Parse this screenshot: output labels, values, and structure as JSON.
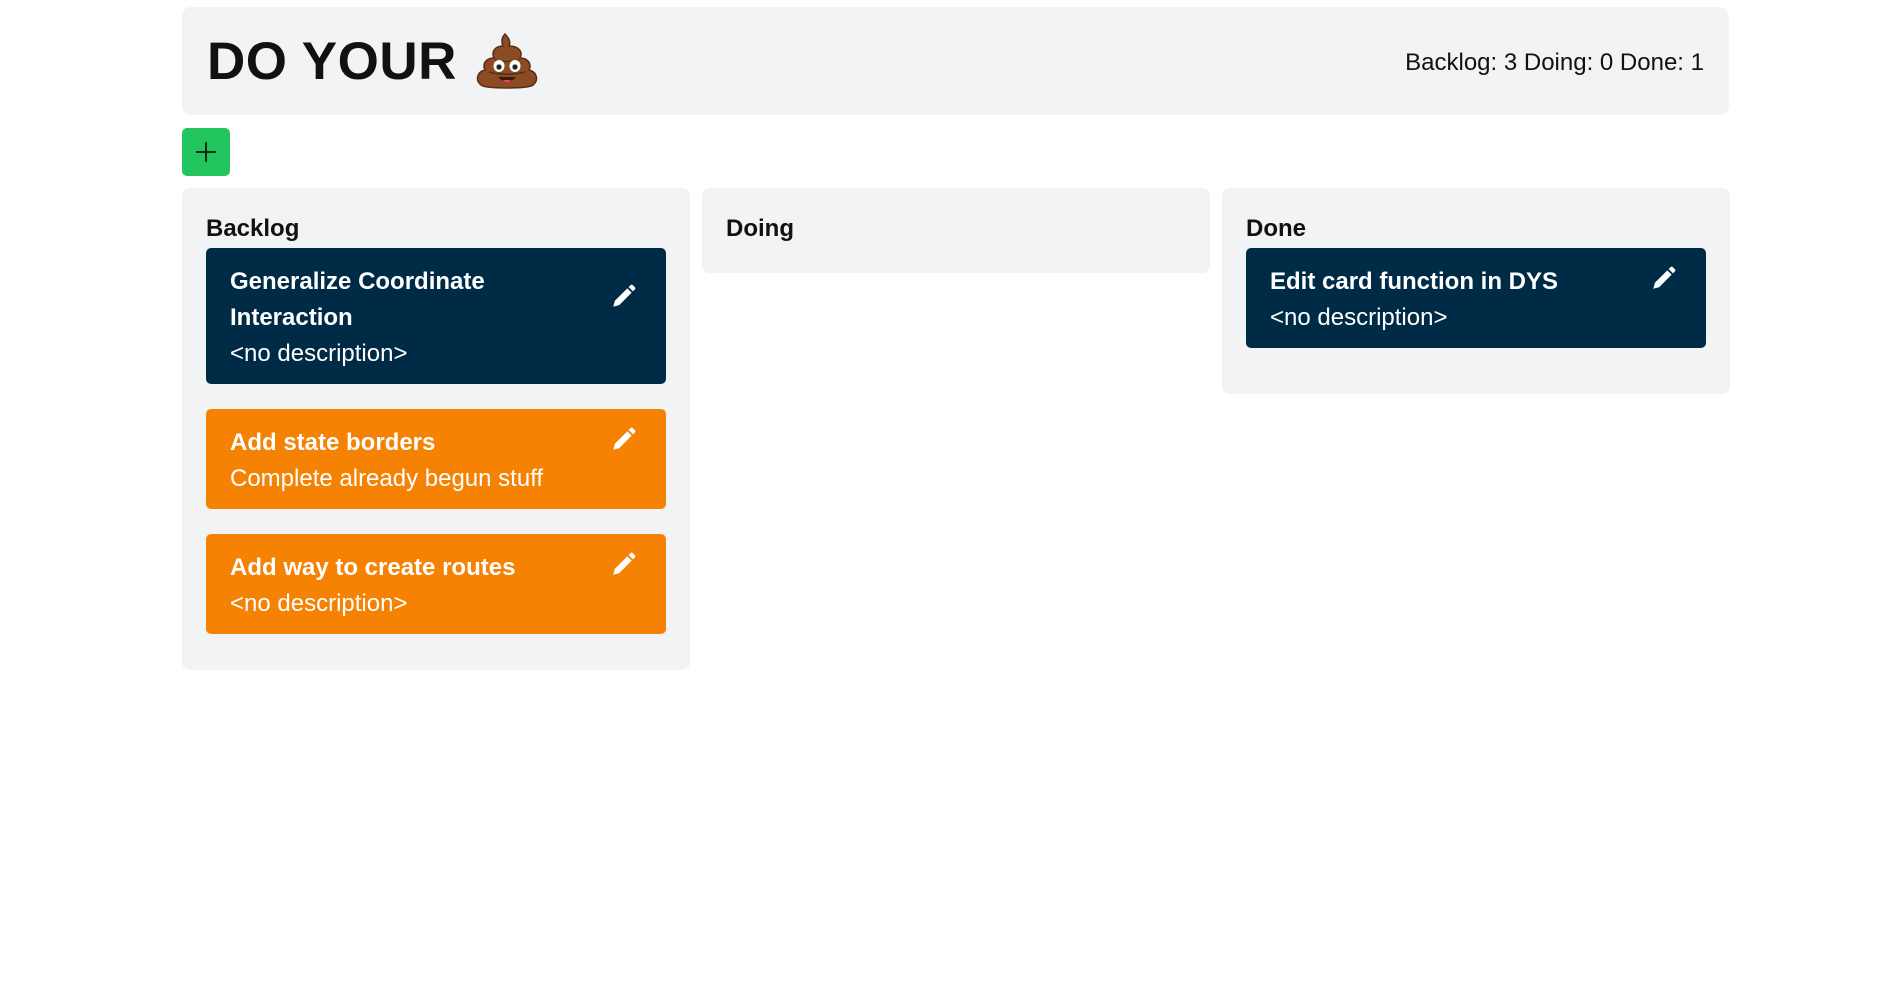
{
  "header": {
    "title": "DO YOUR",
    "emoji_icon": "pile-of-poo-icon",
    "counts": "Backlog: 3 Doing: 0 Done: 1"
  },
  "toolbar": {
    "add_icon": "plus-icon",
    "add_color": "#22c55e"
  },
  "colors": {
    "card_dark": "#002b47",
    "card_orange": "#f58202",
    "panel_bg": "#f2f3f5"
  },
  "columns": [
    {
      "title": "Backlog",
      "cards": [
        {
          "title": "Generalize Coordinate Interaction",
          "description": "<no description>",
          "color": "dark"
        },
        {
          "title": "Add state borders",
          "description": "Complete already begun stuff",
          "color": "orange"
        },
        {
          "title": "Add way to create routes",
          "description": "<no description>",
          "color": "orange"
        }
      ]
    },
    {
      "title": "Doing",
      "cards": []
    },
    {
      "title": "Done",
      "cards": [
        {
          "title": "Edit card function in DYS",
          "description": "<no description>",
          "color": "dark"
        }
      ]
    }
  ]
}
